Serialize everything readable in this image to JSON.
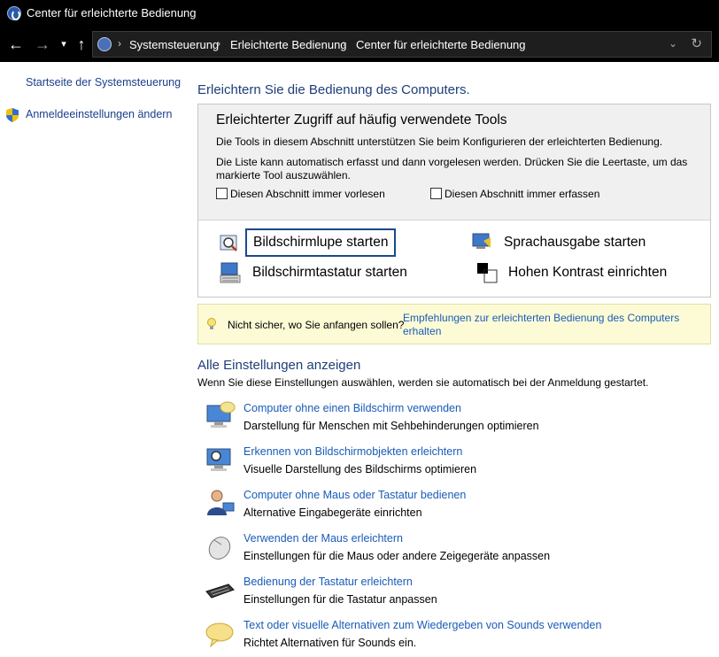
{
  "window": {
    "title": "Center für erleichterte Bedienung"
  },
  "nav": {
    "back_icon": "←",
    "forward_icon": "→",
    "history_icon": "▾",
    "up_icon": "↑"
  },
  "address": {
    "crumbs": [
      "Systemsteuerung",
      "Erleichterte Bedienung",
      "Center für erleichterte Bedienung"
    ],
    "separator": "›",
    "dropdown_icon": "⌄",
    "refresh_icon": "↻"
  },
  "sidebar": {
    "items": [
      {
        "label": "Startseite der Systemsteuerung"
      },
      {
        "label": "Anmeldeeinstellungen ändern"
      }
    ]
  },
  "main": {
    "heading": "Erleichtern Sie die Bedienung des Computers.",
    "tools": {
      "title": "Erleichterter Zugriff auf häufig verwendete Tools",
      "desc1": "Die Tools in diesem Abschnitt unterstützen Sie beim Konfigurieren der erleichterten Bedienung.",
      "desc2a": "Die Liste kann automatisch erfasst und dann vorgelesen werden. Drücken Sie die Leertaste, um das",
      "desc2b": "markierte Tool auszuwählen.",
      "check_read": "Diesen Abschnitt immer vorlesen",
      "check_capture": "Diesen Abschnitt immer erfassen",
      "magnifier": "Bildschirmlupe starten",
      "narrator": "Sprachausgabe starten",
      "keyboard": "Bildschirmtastatur starten",
      "contrast": "Hohen Kontrast einrichten"
    },
    "hint": {
      "text": "Nicht sicher, wo Sie anfangen sollen?",
      "link_a": "Empfehlungen zur erleichterten Bedienung des Computers",
      "link_b": "erhalten"
    },
    "all": {
      "heading": "Alle Einstellungen anzeigen",
      "desc": "Wenn Sie diese Einstellungen auswählen, werden sie automatisch bei der Anmeldung gestartet.",
      "items": [
        {
          "link": "Computer ohne einen Bildschirm verwenden",
          "desc": "Darstellung für Menschen mit Sehbehinderungen optimieren"
        },
        {
          "link": "Erkennen von Bildschirmobjekten erleichtern",
          "desc": "Visuelle Darstellung des Bildschirms optimieren"
        },
        {
          "link": "Computer ohne Maus oder Tastatur bedienen",
          "desc": "Alternative Eingabegeräte einrichten"
        },
        {
          "link": "Verwenden der Maus erleichtern",
          "desc": "Einstellungen für die Maus oder andere Zeigegeräte anpassen"
        },
        {
          "link": "Bedienung der Tastatur erleichtern",
          "desc": "Einstellungen für die Tastatur anpassen"
        },
        {
          "link": "Text oder visuelle Alternativen zum Wiedergeben von Sounds verwenden",
          "desc": "Richtet Alternativen für Sounds ein."
        }
      ]
    }
  }
}
